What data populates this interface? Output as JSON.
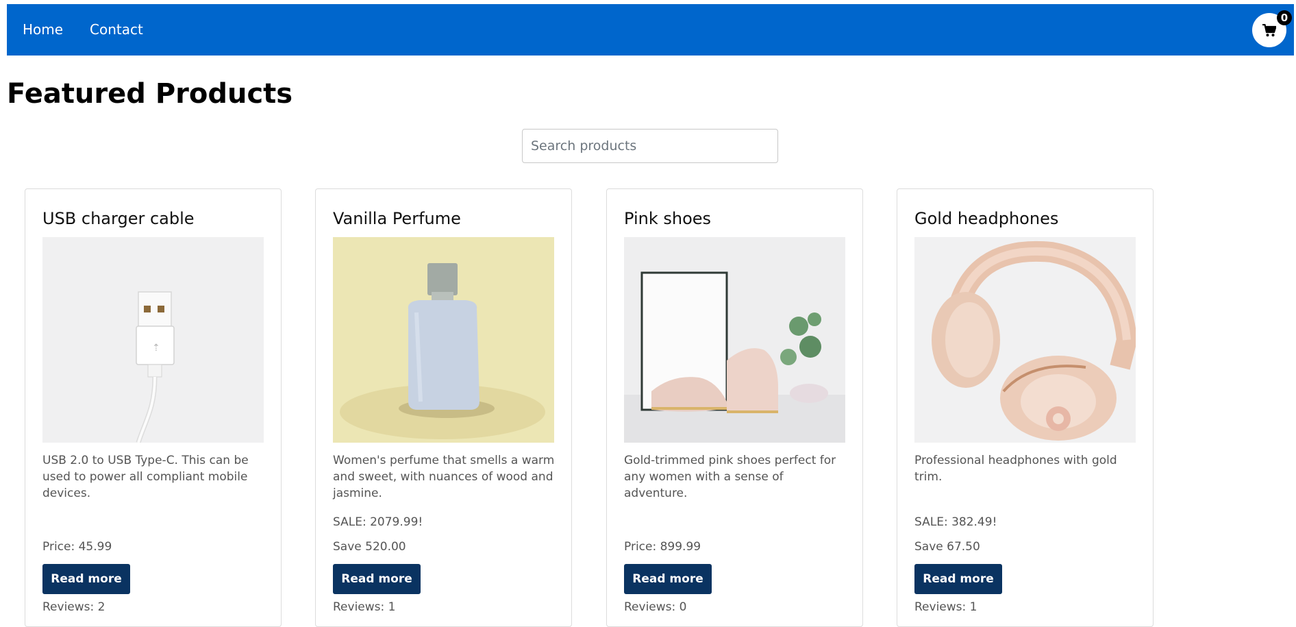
{
  "nav": {
    "home": "Home",
    "contact": "Contact",
    "cart_icon": "cart-icon",
    "cart_count": "0"
  },
  "page": {
    "title": "Featured Products"
  },
  "search": {
    "placeholder": "Search products",
    "value": ""
  },
  "colors": {
    "navbar": "#0066cc",
    "button": "#0a3361"
  },
  "products": [
    {
      "name": "USB charger cable",
      "image": "usb-cable-image",
      "description": "USB 2.0 to USB Type-C. This can be used to power all compliant mobile devices.",
      "line_a": "",
      "line_b": "Price: 45.99",
      "button": "Read more",
      "reviews": "Reviews: 2"
    },
    {
      "name": "Vanilla Perfume",
      "image": "perfume-bottle-image",
      "description": "Women's perfume that smells a warm and sweet, with nuances of wood and jasmine.",
      "line_a": "SALE: 2079.99!",
      "line_b": "Save 520.00",
      "button": "Read more",
      "reviews": "Reviews: 1"
    },
    {
      "name": "Pink shoes",
      "image": "pink-shoes-image",
      "description": "Gold-trimmed pink shoes perfect for any women with a sense of adventure.",
      "line_a": "",
      "line_b": "Price: 899.99",
      "button": "Read more",
      "reviews": "Reviews: 0"
    },
    {
      "name": "Gold headphones",
      "image": "gold-headphones-image",
      "description": "Professional headphones with gold trim.",
      "line_a": "SALE: 382.49!",
      "line_b": "Save 67.50",
      "button": "Read more",
      "reviews": "Reviews: 1"
    }
  ]
}
